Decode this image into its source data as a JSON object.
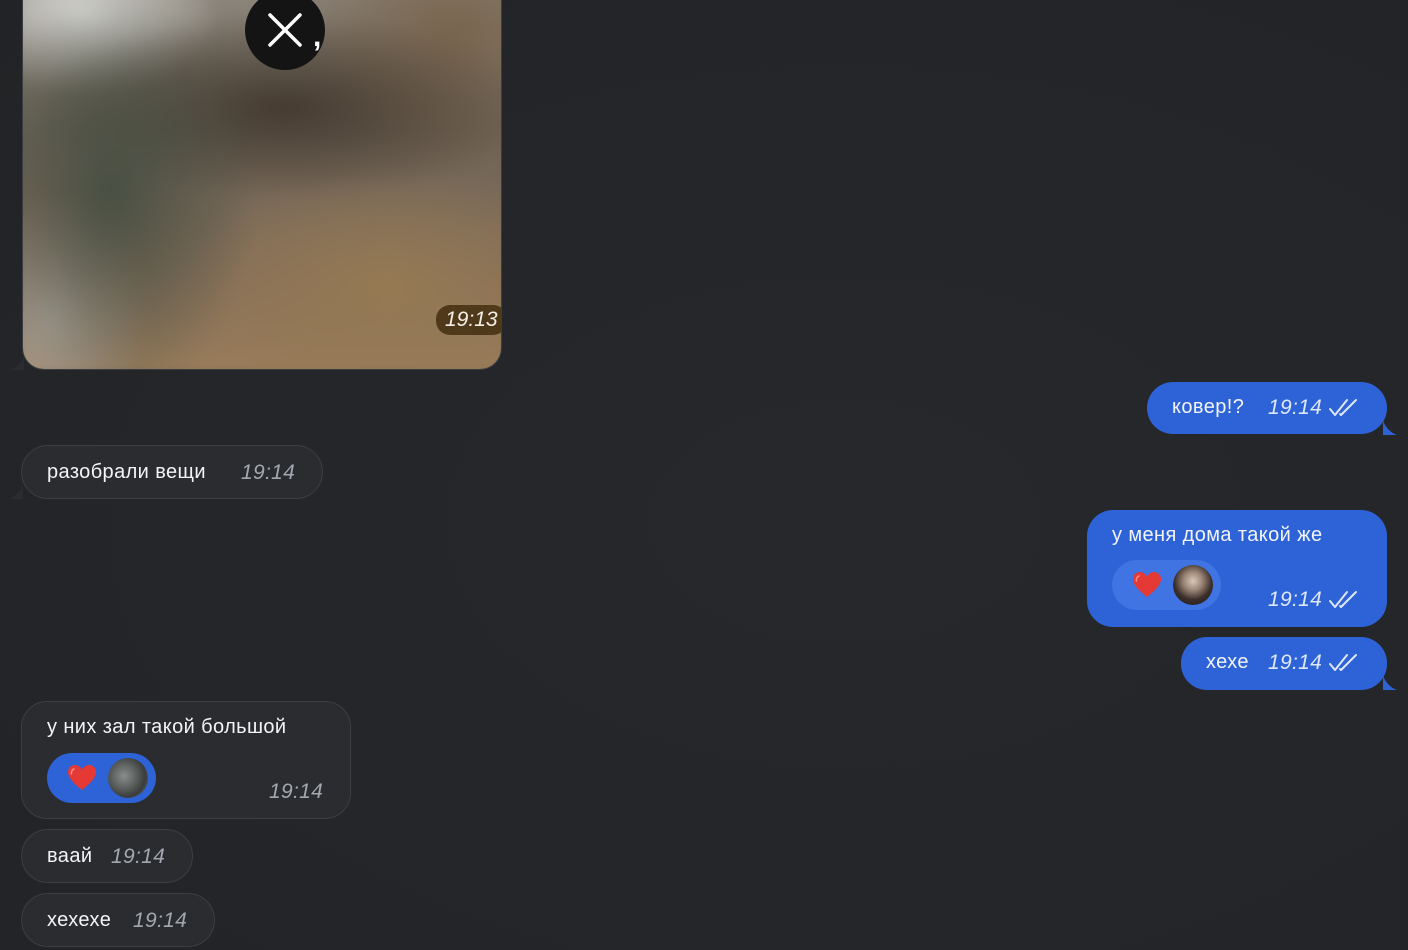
{
  "messages": {
    "image_message": {
      "time": "19:13",
      "close_glyph": ","
    },
    "kover": {
      "text": "ковер!?",
      "time": "19:14"
    },
    "razobrali": {
      "text": "разобрали вещи",
      "time": "19:14"
    },
    "u_menya": {
      "text": "у меня дома такой же",
      "time": "19:14",
      "reaction": "heart"
    },
    "hehe": {
      "text": "хехе",
      "time": "19:14"
    },
    "u_nih": {
      "text": "у них зал такой большой",
      "time": "19:14",
      "reaction": "heart"
    },
    "vaai": {
      "text": "ваай",
      "time": "19:14"
    },
    "hehehe": {
      "text": "хехехе",
      "time": "19:14"
    }
  },
  "colors": {
    "background": "#24262a",
    "incoming_bubble": "#2a2c30",
    "outgoing_bubble": "#2d63d6",
    "reaction_heart": "#e53935"
  }
}
